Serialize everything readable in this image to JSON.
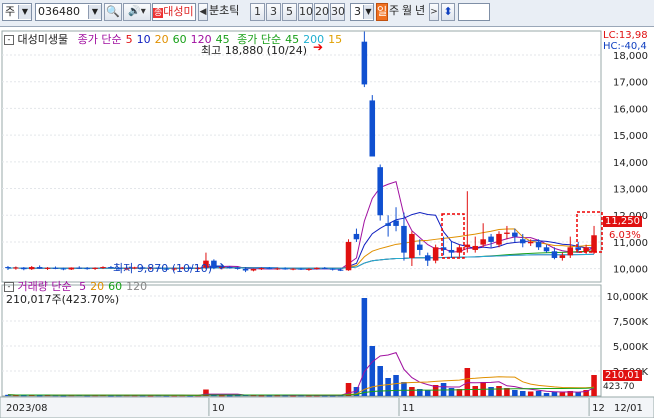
{
  "toolbar": {
    "market_label": "주",
    "code_value": "036480",
    "stock_name": "대성미생물",
    "unit_label": "분",
    "tick_label": "초",
    "tick2_label": "틱",
    "periods": [
      "1",
      "3",
      "5",
      "10",
      "20",
      "30"
    ],
    "period_count": "3",
    "day_label": "일",
    "week_label": "주",
    "month_label": "월",
    "year_label": "년",
    "prev_icon": "left-arrow-icon",
    "next_icon": "right-arrow-icon"
  },
  "price_panel": {
    "stock_label": "대성미생물",
    "ma_label": "종가 단순",
    "ma_periods": [
      {
        "label": "5",
        "color": "#e01010"
      },
      {
        "label": "10",
        "color": "#1020c0"
      },
      {
        "label": "20",
        "color": "#e09000"
      },
      {
        "label": "60",
        "color": "#18a018"
      },
      {
        "label": "120",
        "color": "#a010a0"
      },
      {
        "label": "45",
        "color": "#18a018"
      }
    ],
    "ma2_label": "종가 단순",
    "ma2_periods": [
      {
        "label": "45",
        "color": "#18a018"
      },
      {
        "label": "200",
        "color": "#20b0d0"
      },
      {
        "label": "15",
        "color": "#e0a000"
      }
    ],
    "lc_label": "LC:13,98",
    "hc_label": "HC:-40,4",
    "high_annotation": "최고 18,880 (10/24)",
    "low_annotation": "최저 9,870 (10/10)",
    "current_price_tag": "11,250",
    "current_pct_tag": "6.03%",
    "y_ticks": [
      "18,000",
      "17,000",
      "16,000",
      "15,000",
      "14,000",
      "13,000",
      "12,000",
      "11,000",
      "10,000"
    ]
  },
  "volume_panel": {
    "label": "거래량 단순",
    "ma_periods": [
      {
        "label": "5",
        "color": "#a010a0"
      },
      {
        "label": "20",
        "color": "#e09000"
      },
      {
        "label": "60",
        "color": "#18a018"
      },
      {
        "label": "120",
        "color": "#888888"
      }
    ],
    "value_text": "210,017주(423.70%)",
    "y_ticks": [
      "10,000K",
      "7,500K",
      "5,000K",
      "2,500K"
    ],
    "vol_tag": "210,01",
    "vol_tag2": "423.70"
  },
  "x_axis": {
    "labels": [
      "2023/08",
      "10",
      "11",
      "12",
      "12/01"
    ]
  },
  "chart_data": {
    "type": "candlestick",
    "price_range": [
      9500,
      18900
    ],
    "volume_range": [
      0,
      10500
    ],
    "volume_unit": "K",
    "candles": [
      [
        10060,
        10100,
        9950,
        10020
      ],
      [
        10020,
        10080,
        9960,
        10040
      ],
      [
        10040,
        10060,
        9940,
        9980
      ],
      [
        9980,
        10100,
        9950,
        10060
      ],
      [
        10060,
        10120,
        9990,
        10000
      ],
      [
        10000,
        10060,
        9950,
        10030
      ],
      [
        10030,
        10080,
        9980,
        10010
      ],
      [
        10010,
        10040,
        9940,
        9970
      ],
      [
        9970,
        10050,
        9950,
        10040
      ],
      [
        10040,
        10090,
        9990,
        10020
      ],
      [
        10020,
        10060,
        9960,
        9990
      ],
      [
        9990,
        10050,
        9950,
        10030
      ],
      [
        10030,
        10090,
        9990,
        10060
      ],
      [
        10060,
        10100,
        10010,
        10020
      ],
      [
        10020,
        10050,
        9960,
        9980
      ],
      [
        9980,
        10040,
        9940,
        10020
      ],
      [
        10020,
        10070,
        9980,
        10050
      ],
      [
        10050,
        10090,
        10000,
        10010
      ],
      [
        10010,
        10060,
        9970,
        10040
      ],
      [
        10040,
        10080,
        9990,
        10000
      ],
      [
        10000,
        10030,
        9950,
        9970
      ],
      [
        9970,
        10030,
        9930,
        10010
      ],
      [
        10010,
        10060,
        9980,
        10040
      ],
      [
        10040,
        10070,
        9990,
        10000
      ],
      [
        10000,
        10060,
        9960,
        10030
      ],
      [
        10030,
        10600,
        9990,
        10300
      ],
      [
        10300,
        10350,
        9980,
        10020
      ],
      [
        10020,
        10080,
        9970,
        10060
      ],
      [
        10060,
        10100,
        10000,
        10030
      ],
      [
        10030,
        10060,
        9960,
        9990
      ],
      [
        9990,
        10040,
        9870,
        9930
      ],
      [
        9930,
        10010,
        9900,
        9990
      ],
      [
        9990,
        10040,
        9950,
        10020
      ],
      [
        10020,
        10060,
        9970,
        10000
      ],
      [
        10000,
        10040,
        9950,
        10010
      ],
      [
        10010,
        10050,
        9960,
        9980
      ],
      [
        9980,
        10020,
        9940,
        10000
      ],
      [
        10000,
        10030,
        9950,
        9970
      ],
      [
        9970,
        10020,
        9920,
        9990
      ],
      [
        9990,
        10050,
        9960,
        10030
      ],
      [
        10030,
        10060,
        9980,
        10000
      ],
      [
        10000,
        10020,
        9930,
        9960
      ],
      [
        9960,
        10010,
        9910,
        9940
      ],
      [
        9940,
        11100,
        9920,
        11000
      ],
      [
        11300,
        11500,
        11000,
        11100
      ],
      [
        18500,
        18880,
        16800,
        16900
      ],
      [
        16300,
        16500,
        14200,
        14200
      ],
      [
        13800,
        13900,
        11800,
        12000
      ],
      [
        11700,
        12000,
        11200,
        11600
      ],
      [
        11800,
        12300,
        11400,
        11600
      ],
      [
        11600,
        12100,
        10300,
        10600
      ],
      [
        10400,
        11400,
        10100,
        11300
      ],
      [
        10900,
        11100,
        10500,
        10700
      ],
      [
        10500,
        10600,
        10100,
        10300
      ],
      [
        10300,
        10900,
        10200,
        10800
      ],
      [
        10800,
        11200,
        10500,
        10700
      ],
      [
        10700,
        11000,
        10400,
        10600
      ],
      [
        10600,
        10900,
        10450,
        10800
      ],
      [
        10800,
        12900,
        10600,
        10900
      ],
      [
        10700,
        11200,
        10600,
        10850
      ],
      [
        10900,
        11700,
        10800,
        11100
      ],
      [
        11200,
        11300,
        10800,
        11000
      ],
      [
        10900,
        11400,
        10800,
        11300
      ],
      [
        11300,
        11600,
        11100,
        11350
      ],
      [
        11350,
        11500,
        11000,
        11200
      ],
      [
        11100,
        11300,
        10800,
        10950
      ],
      [
        10950,
        11100,
        10850,
        11000
      ],
      [
        11000,
        11100,
        10700,
        10800
      ],
      [
        10800,
        10900,
        10600,
        10650
      ],
      [
        10650,
        10800,
        10350,
        10400
      ],
      [
        10400,
        10600,
        10300,
        10500
      ],
      [
        10500,
        11200,
        10400,
        10800
      ],
      [
        10800,
        11000,
        10650,
        10700
      ],
      [
        10650,
        10900,
        10550,
        10800
      ],
      [
        10600,
        11600,
        10550,
        11250
      ]
    ],
    "volumes": [
      120,
      90,
      80,
      110,
      70,
      95,
      80,
      60,
      90,
      100,
      70,
      85,
      95,
      60,
      75,
      90,
      80,
      70,
      65,
      85,
      60,
      70,
      80,
      55,
      75,
      650,
      90,
      70,
      60,
      85,
      120,
      90,
      70,
      60,
      80,
      70,
      60,
      75,
      65,
      70,
      60,
      55,
      80,
      1300,
      900,
      9800,
      5000,
      3000,
      1800,
      2100,
      1400,
      900,
      700,
      600,
      1100,
      1300,
      800,
      700,
      2800,
      1000,
      1400,
      900,
      1000,
      800,
      600,
      500,
      450,
      500,
      300,
      400,
      350,
      500,
      400,
      600,
      2100
    ],
    "ma_series": [
      {
        "name": "5",
        "color": "#a010a0"
      },
      {
        "name": "10",
        "color": "#1020c0"
      },
      {
        "name": "20",
        "color": "#e09000"
      },
      {
        "name": "60",
        "color": "#18a018"
      },
      {
        "name": "120",
        "color": "#a010a0"
      },
      {
        "name": "200",
        "color": "#20b0d0"
      }
    ]
  }
}
